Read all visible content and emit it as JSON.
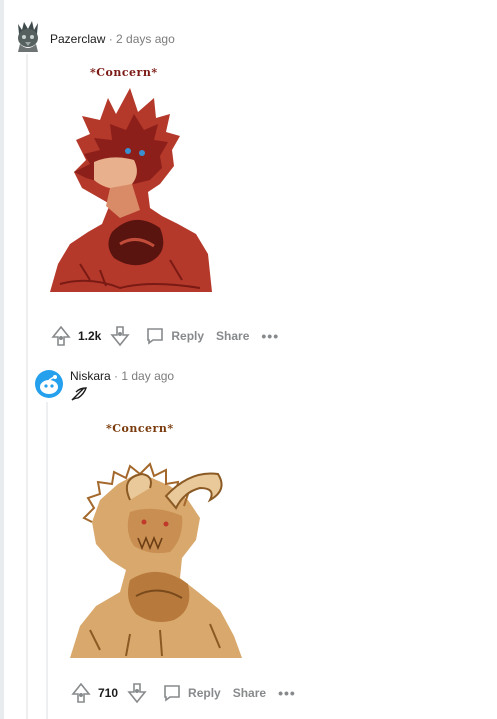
{
  "colors": {
    "page_bg": "#ffffff",
    "text_muted": "#7c7c7c",
    "action_gray": "#878a8c",
    "thread_line": "#edeff1",
    "avatar_blue": "#24a0ed"
  },
  "comments": [
    {
      "author": "Pazerclaw",
      "separator": "·",
      "time": "2 days ago",
      "image_caption": "*Concern*",
      "image_subject": "red spiky dragon with hands clasped",
      "score": "1.2k",
      "reply_label": "Reply",
      "share_label": "Share",
      "more_label": "•••",
      "icons": {
        "upvote": "upvote-arrow-icon",
        "downvote": "downvote-arrow-icon",
        "reply": "speech-bubble-icon",
        "more": "ellipsis-icon"
      }
    },
    {
      "author": "Niskara",
      "separator": "·",
      "time": "1 day ago",
      "flair_icon": "feather-quill-icon",
      "image_caption": "*Concern*",
      "image_subject": "tan horned beast with hands clasped",
      "score": "710",
      "reply_label": "Reply",
      "share_label": "Share",
      "more_label": "•••",
      "icons": {
        "upvote": "upvote-arrow-icon",
        "downvote": "downvote-arrow-icon",
        "reply": "speech-bubble-icon",
        "more": "ellipsis-icon"
      }
    }
  ]
}
